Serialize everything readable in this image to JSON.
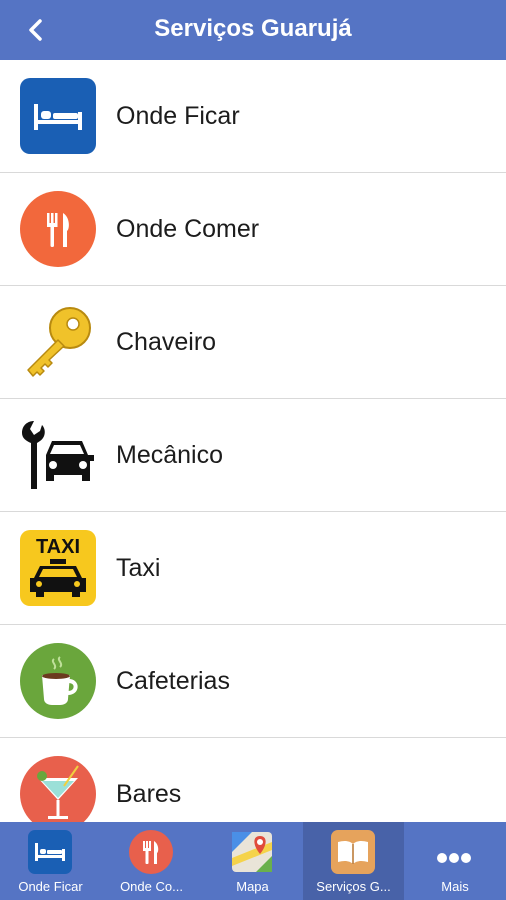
{
  "header": {
    "title": "Serviços Guarujá",
    "back_icon": "chevron-left-icon"
  },
  "list": {
    "items": [
      {
        "label": "Onde Ficar",
        "icon": "bed-icon"
      },
      {
        "label": "Onde Comer",
        "icon": "fork-knife-icon"
      },
      {
        "label": "Chaveiro",
        "icon": "key-icon"
      },
      {
        "label": "Mecânico",
        "icon": "wrench-car-icon"
      },
      {
        "label": "Taxi",
        "icon": "taxi-icon",
        "icon_text": "TAXI"
      },
      {
        "label": "Cafeterias",
        "icon": "coffee-cup-icon"
      },
      {
        "label": "Bares",
        "icon": "cocktail-icon"
      }
    ]
  },
  "tabbar": {
    "tabs": [
      {
        "label": "Onde Ficar",
        "icon": "bed-icon"
      },
      {
        "label": "Onde Co...",
        "icon": "fork-knife-icon"
      },
      {
        "label": "Mapa",
        "icon": "map-icon"
      },
      {
        "label": "Serviços G...",
        "icon": "book-icon",
        "active": true
      },
      {
        "label": "Mais",
        "icon": "more-dots-icon"
      }
    ]
  },
  "colors": {
    "header_bg": "#5574c4",
    "tab_active_bg": "#4862a8",
    "divider": "#d9d9d9",
    "bed_icon_bg": "#1a5fb4",
    "food_icon_bg": "#f2683c",
    "key_gold": "#f0c22a",
    "taxi_yellow": "#f7c81e",
    "coffee_icon_bg": "#6aa63c",
    "bar_icon_bg": "#e8604c"
  }
}
